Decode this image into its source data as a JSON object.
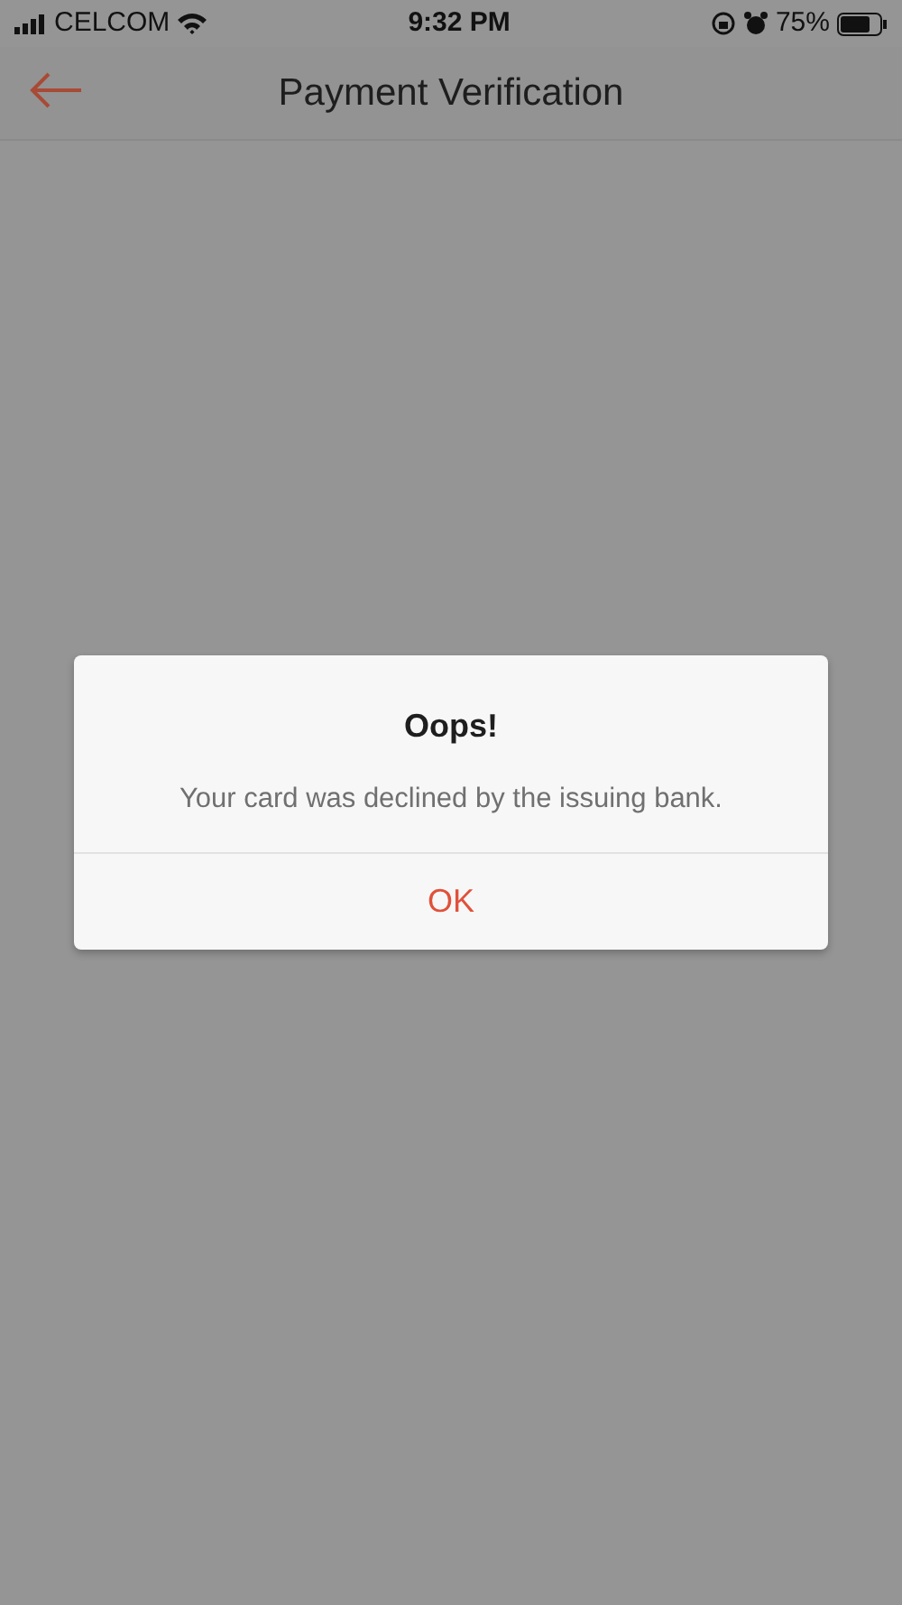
{
  "status_bar": {
    "carrier": "CELCOM",
    "time": "9:32 PM",
    "battery": "75%"
  },
  "header": {
    "title": "Payment Verification"
  },
  "dialog": {
    "title": "Oops!",
    "message": "Your card was declined by the issuing bank.",
    "buttons": [
      "OK"
    ]
  }
}
